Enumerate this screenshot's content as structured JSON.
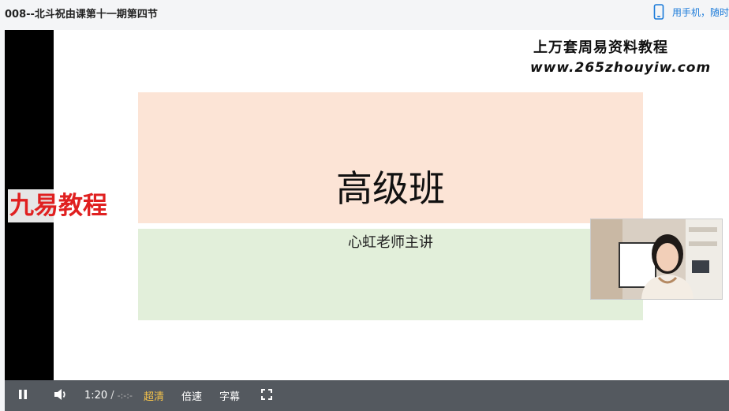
{
  "header": {
    "title": "008--北斗祝由课第十一期第四节",
    "phone_link": "用手机，随时"
  },
  "slide": {
    "heading": "高级班",
    "subheading": "心虹老师主讲"
  },
  "watermarks": {
    "top_title": "上万套周易资料教程",
    "top_url": "www.265zhouyiw.com",
    "brand": "九易教程"
  },
  "controls": {
    "current_time": "1:20",
    "separator": "/",
    "duration": "-:-:-",
    "quality_label": "超清",
    "speed_label": "倍速",
    "subtitle_label": "字幕"
  },
  "colors": {
    "accent": "#1a7ad9",
    "quality": "#f4c24a",
    "brand_watermark": "#e02020",
    "control_bar": "#54595f"
  }
}
